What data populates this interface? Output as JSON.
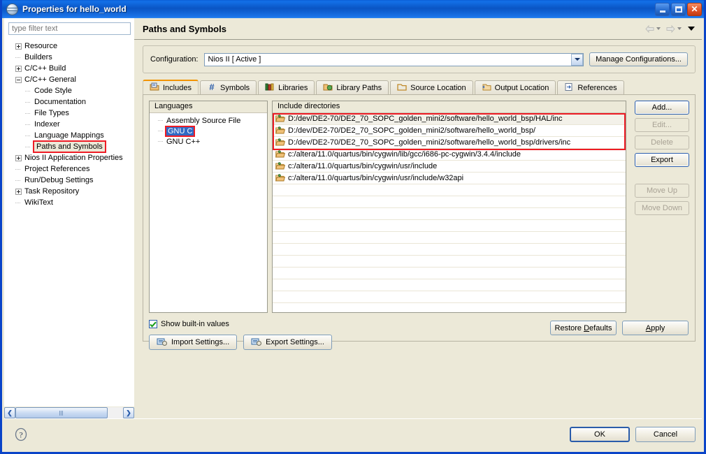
{
  "window": {
    "title": "Properties for hello_world",
    "icon": "eclipse-globe-icon",
    "minimize_label": "Minimize",
    "maximize_label": "Maximize",
    "close_label": "Close"
  },
  "sidebar": {
    "filter_placeholder": "type filter text",
    "filter_value": "",
    "items": [
      {
        "label": "Resource",
        "indent": 0,
        "expander": "plus"
      },
      {
        "label": "Builders",
        "indent": 0,
        "expander": "none"
      },
      {
        "label": "C/C++ Build",
        "indent": 0,
        "expander": "plus"
      },
      {
        "label": "C/C++ General",
        "indent": 0,
        "expander": "minus"
      },
      {
        "label": "Code Style",
        "indent": 1,
        "expander": "none"
      },
      {
        "label": "Documentation",
        "indent": 1,
        "expander": "none"
      },
      {
        "label": "File Types",
        "indent": 1,
        "expander": "none"
      },
      {
        "label": "Indexer",
        "indent": 1,
        "expander": "none"
      },
      {
        "label": "Language Mappings",
        "indent": 1,
        "expander": "none"
      },
      {
        "label": "Paths and Symbols",
        "indent": 1,
        "expander": "none",
        "selected": true
      },
      {
        "label": "Nios II Application Properties",
        "indent": 0,
        "expander": "plus"
      },
      {
        "label": "Project References",
        "indent": 0,
        "expander": "none"
      },
      {
        "label": "Run/Debug Settings",
        "indent": 0,
        "expander": "none"
      },
      {
        "label": "Task Repository",
        "indent": 0,
        "expander": "plus"
      },
      {
        "label": "WikiText",
        "indent": 0,
        "expander": "none"
      }
    ],
    "scroll_left_label": "❮",
    "scroll_right_label": "❯"
  },
  "page": {
    "title": "Paths and Symbols",
    "back_icon": "back-arrow-icon",
    "forward_icon": "forward-arrow-icon",
    "menu_icon": "view-menu-caret-icon"
  },
  "configuration": {
    "label": "Configuration:",
    "value": "Nios II  [ Active ]",
    "manage_label": "Manage Configurations..."
  },
  "tabs": [
    {
      "label": "Includes",
      "icon": "includes-icon",
      "active": true
    },
    {
      "label": "Symbols",
      "icon": "hash-icon",
      "active": false
    },
    {
      "label": "Libraries",
      "icon": "books-icon",
      "active": false
    },
    {
      "label": "Library Paths",
      "icon": "library-paths-icon",
      "active": false
    },
    {
      "label": "Source Location",
      "icon": "source-folder-icon",
      "active": false
    },
    {
      "label": "Output Location",
      "icon": "output-folder-icon",
      "active": false
    },
    {
      "label": "References",
      "icon": "references-icon",
      "active": false
    }
  ],
  "languages": {
    "header": "Languages",
    "items": [
      {
        "label": "Assembly Source File",
        "selected": false
      },
      {
        "label": "GNU C",
        "selected": true
      },
      {
        "label": "GNU C++",
        "selected": false
      }
    ]
  },
  "include_directories": {
    "header": "Include directories",
    "items": [
      {
        "path": "D:/dev/DE2-70/DE2_70_SOPC_golden_mini2/software/hello_world_bsp/HAL/inc",
        "icon": "folder-icon",
        "highlighted": true
      },
      {
        "path": "D:/dev/DE2-70/DE2_70_SOPC_golden_mini2/software/hello_world_bsp/",
        "icon": "folder-icon",
        "highlighted": true
      },
      {
        "path": "D:/dev/DE2-70/DE2_70_SOPC_golden_mini2/software/hello_world_bsp/drivers/inc",
        "icon": "folder-icon",
        "highlighted": true
      },
      {
        "path": "c:/altera/11.0/quartus/bin/cygwin/lib/gcc/i686-pc-cygwin/3.4.4/include",
        "icon": "folder-icon",
        "highlighted": false
      },
      {
        "path": "c:/altera/11.0/quartus/bin/cygwin/usr/include",
        "icon": "folder-icon",
        "highlighted": false
      },
      {
        "path": "c:/altera/11.0/quartus/bin/cygwin/usr/include/w32api",
        "icon": "folder-icon",
        "highlighted": false
      }
    ]
  },
  "side_buttons": [
    {
      "label": "Add...",
      "enabled": true,
      "focused": true
    },
    {
      "label": "Edit...",
      "enabled": false
    },
    {
      "label": "Delete",
      "enabled": false
    },
    {
      "label": "Export",
      "enabled": true,
      "focused": true
    },
    {
      "label": "Move Up",
      "enabled": false
    },
    {
      "label": "Move Down",
      "enabled": false
    }
  ],
  "options": {
    "show_builtin_label": "Show built-in values",
    "show_builtin_checked": true,
    "import_settings_label": "Import Settings...",
    "export_settings_label": "Export Settings...",
    "import_icon": "import-settings-icon",
    "export_icon": "export-settings-icon"
  },
  "footer": {
    "restore_defaults_label": "Restore Defaults",
    "restore_defaults_mnemonic": "D",
    "apply_label": "Apply",
    "apply_mnemonic": "A",
    "help_icon": "help-question-icon",
    "ok_label": "OK",
    "cancel_label": "Cancel"
  },
  "annotations": {
    "highlight_color": "#ee1c25",
    "count": 3
  }
}
